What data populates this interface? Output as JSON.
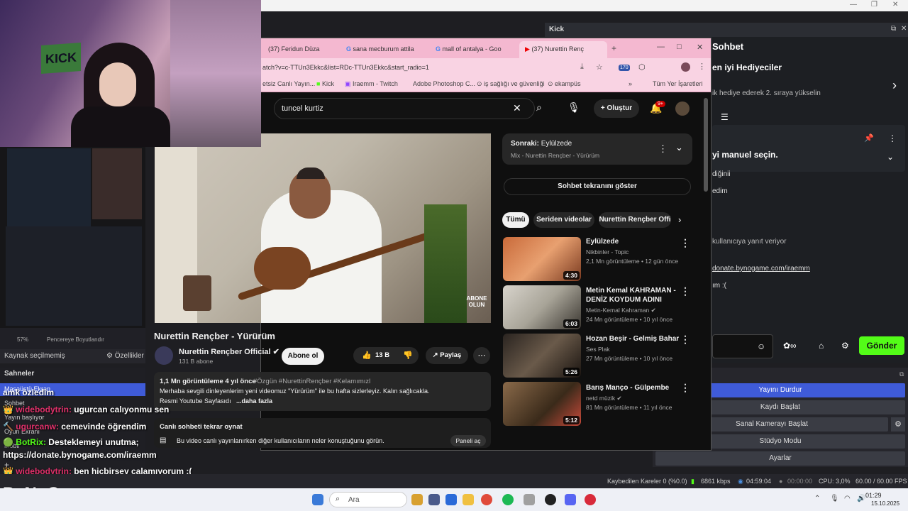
{
  "obs": {
    "right_dock_title": "Kick",
    "chat": {
      "title": "Sohbet",
      "top_gifters": "en iyi Hediyeciler",
      "gift_hint": "ik hediye ederek 2. sıraya yükselin",
      "manual_select": "yi manuel seçin.",
      "line1": "diğinii",
      "line2": "edim",
      "reply_hint": "kullanıcıya yanıt veriyor",
      "link": "donate.bynogame.com/iraemm",
      "line3": "ım :(",
      "send_button": "Gönder"
    },
    "controls": {
      "stop_stream": "Yayını Durdur",
      "start_record": "Kaydı Başlat",
      "start_vcam": "Sanal Kamerayı Başlat",
      "studio_mode": "Stüdyo Modu",
      "settings": "Ayarlar"
    },
    "left": {
      "source_none": "Kaynak seçilmemiş",
      "properties": "Özellikler",
      "zoom": "57%",
      "fit_window": "Pencereye Boyutlandır",
      "scenes_title": "Sahneler",
      "scene_desktop": "Masaüstü Ekran",
      "scene_chat": "Sohbet",
      "scene_starting": "Yayın başlıyor",
      "scene_game": "Oyun Ekranı",
      "scene_mobile": "Mobil"
    },
    "status": {
      "dropped": "Kaybedilen Kareler 0 (%0.0)",
      "bitrate": "6861 kbps",
      "stream_time": "04:59:04",
      "rec_time": "00:00:00",
      "cpu": "CPU: 3,0%",
      "fps": "60.00 / 60.00 FPS"
    }
  },
  "chat_overlay": [
    {
      "user": "",
      "msg": "amk özledim"
    },
    {
      "user": "widebodytrin:",
      "msg": "ugurcan calıyonmu sen"
    },
    {
      "user": "ugurcanw:",
      "msg": "cemevinde öğrendim"
    },
    {
      "user": "BotRix:",
      "msg": "Desteklemeyi unutma;"
    },
    {
      "user": "",
      "msg": "https://donate.bynogame.com/iraemm"
    },
    {
      "user": "widebodytrin:",
      "msg": "ben hiçbirşey çalamıyorum :("
    }
  ],
  "brand_overlay": "ByNoGame",
  "browser": {
    "tabs": [
      {
        "label": "(37) Feridun Düza"
      },
      {
        "label": "sana mecburum attila"
      },
      {
        "label": "mall of antalya - Goo"
      },
      {
        "label": "(37) Nurettin Renç"
      }
    ],
    "url": "atch?v=c-TTUn3Ekkc&list=RDc-TTUn3Ekkc&start_radio=1",
    "notif_badge": "170",
    "bookmarks": [
      "etsiz Canlı Yayın...",
      "Kick",
      "Iraemm - Twitch",
      "Adobe Photoshop C...",
      "iş sağlığı ve güvenliği",
      "ekampüs",
      "Tüm Yer İşaretleri"
    ]
  },
  "youtube": {
    "search_value": "tuncel kurtiz",
    "create_label": "Oluştur",
    "notif_count": "9+",
    "video_title": "Nurettin Rençber - Yürürüm",
    "subscribe_overlay": "ABONE OLUN",
    "channel_name": "Nurettin Rençber Official",
    "subscribers": "131 B abone",
    "subscribe_button": "Abone ol",
    "likes": "13 B",
    "share": "Paylaş",
    "views_line": "1,1 Mn görüntüleme  4 yıl önce",
    "hashtags": "#Özgün #NurettinRençber #Kelamımızl",
    "desc1": "Merhaba sevgili dinleyenlerim yeni videomuz \"Yürürüm\" ile  bu hafta sizlerleyiz. Kalın sağlıcakla.",
    "desc2": "Resmi Youtube Sayfasıdı",
    "more": "...daha fazla",
    "replay_chat": "Canlı sohbeti tekrar oynat",
    "replay_desc": "Bu video canlı yayınlanırken diğer kullanıcıların neler konuştuğunu görün.",
    "panel_button": "Paneli aç",
    "next_label": "Sonraki:",
    "next_title": "Eylülzede",
    "mix_label": "Mix - Nurettin Rençber - Yürürüm",
    "show_chat": "Sohbet tekranını göster",
    "chips": [
      "Tümü",
      "Seriden videolar",
      "Nurettin Rençber Offi"
    ],
    "recommendations": [
      {
        "title": "Eylülzede",
        "channel": "Nikbinler - Topic",
        "meta": "2,1 Mn görüntüleme • 12 gün önce",
        "duration": "4:30"
      },
      {
        "title": "Metin Kemal KAHRAMAN - DENİZ KOYDUM ADINI",
        "channel": "Metin-Kemal Kahraman",
        "meta": "24 Mn görüntüleme • 10 yıl önce",
        "duration": "6:03"
      },
      {
        "title": "Hozan Beşir - Gelmiş Bahar",
        "channel": "Ses Plak",
        "meta": "27 Mn görüntüleme • 10 yıl önce",
        "duration": "5:26"
      },
      {
        "title": "Barış Manço - Gülpembe",
        "channel": "netd müzik",
        "meta": "81 Mn görüntüleme • 11 yıl önce",
        "duration": "5:12"
      }
    ]
  },
  "taskbar": {
    "search": "Ara",
    "time": "01:29",
    "date": "15.10.2025"
  }
}
